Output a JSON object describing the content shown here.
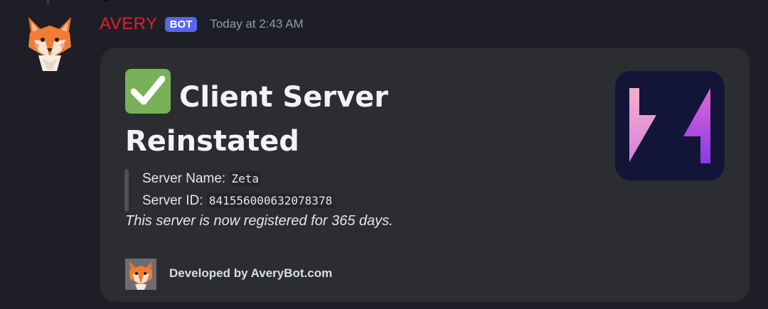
{
  "message": {
    "username": "AVERY",
    "bot_badge": "BOT",
    "timestamp": "Today at 2:43 AM"
  },
  "embed": {
    "title": "Client Server Reinstated",
    "title_emoji": "white-check-mark-emoji",
    "fields": [
      {
        "label": "Server Name:",
        "value": "Zeta"
      },
      {
        "label": "Server ID:",
        "value": "841556000632078378"
      }
    ],
    "note": "This server is now registered for 365 days.",
    "footer_text": "Developed by AveryBot.com",
    "thumbnail": "zeta-logo"
  },
  "colors": {
    "background": "#1e1f26",
    "embed_bg": "#2b2d31",
    "username": "#e11d2a",
    "badge": "#5865f2",
    "check": "#78b159",
    "logo_bg": "#121538"
  }
}
